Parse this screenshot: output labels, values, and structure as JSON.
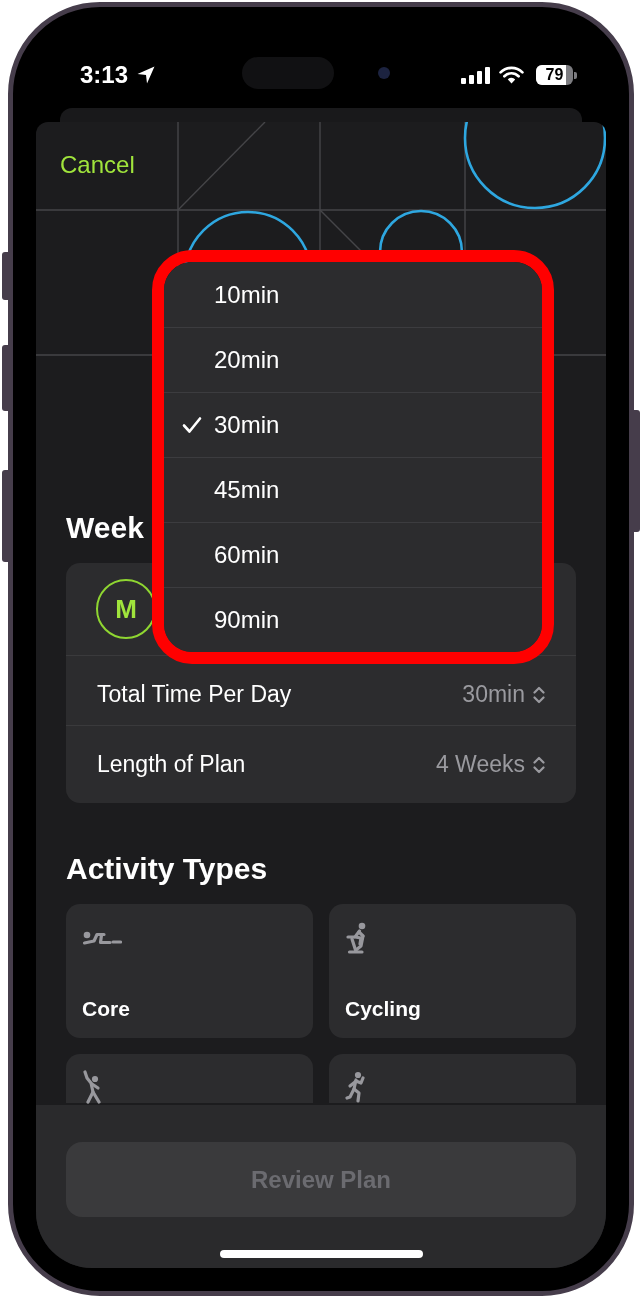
{
  "status_bar": {
    "time": "3:13",
    "battery": "79"
  },
  "sheet": {
    "cancel": "Cancel"
  },
  "weekly": {
    "heading": "Week",
    "days": [
      {
        "label": "M"
      }
    ],
    "settings": [
      {
        "label": "Total Time Per Day",
        "value": "30min"
      },
      {
        "label": "Length of Plan",
        "value": "4 Weeks"
      }
    ]
  },
  "activity_types": {
    "heading": "Activity Types",
    "tiles": [
      {
        "kind": "reclining",
        "label": "Core"
      },
      {
        "kind": "cycling",
        "label": "Cycling"
      },
      {
        "kind": "dancing"
      },
      {
        "kind": "running"
      }
    ]
  },
  "duration_menu": {
    "options": [
      {
        "label": "10min",
        "selected": false
      },
      {
        "label": "20min",
        "selected": false
      },
      {
        "label": "30min",
        "selected": true
      },
      {
        "label": "45min",
        "selected": false
      },
      {
        "label": "60min",
        "selected": false
      },
      {
        "label": "90min",
        "selected": false
      }
    ]
  },
  "footer": {
    "review_button": {
      "label": "Review Plan",
      "disabled": true
    }
  }
}
